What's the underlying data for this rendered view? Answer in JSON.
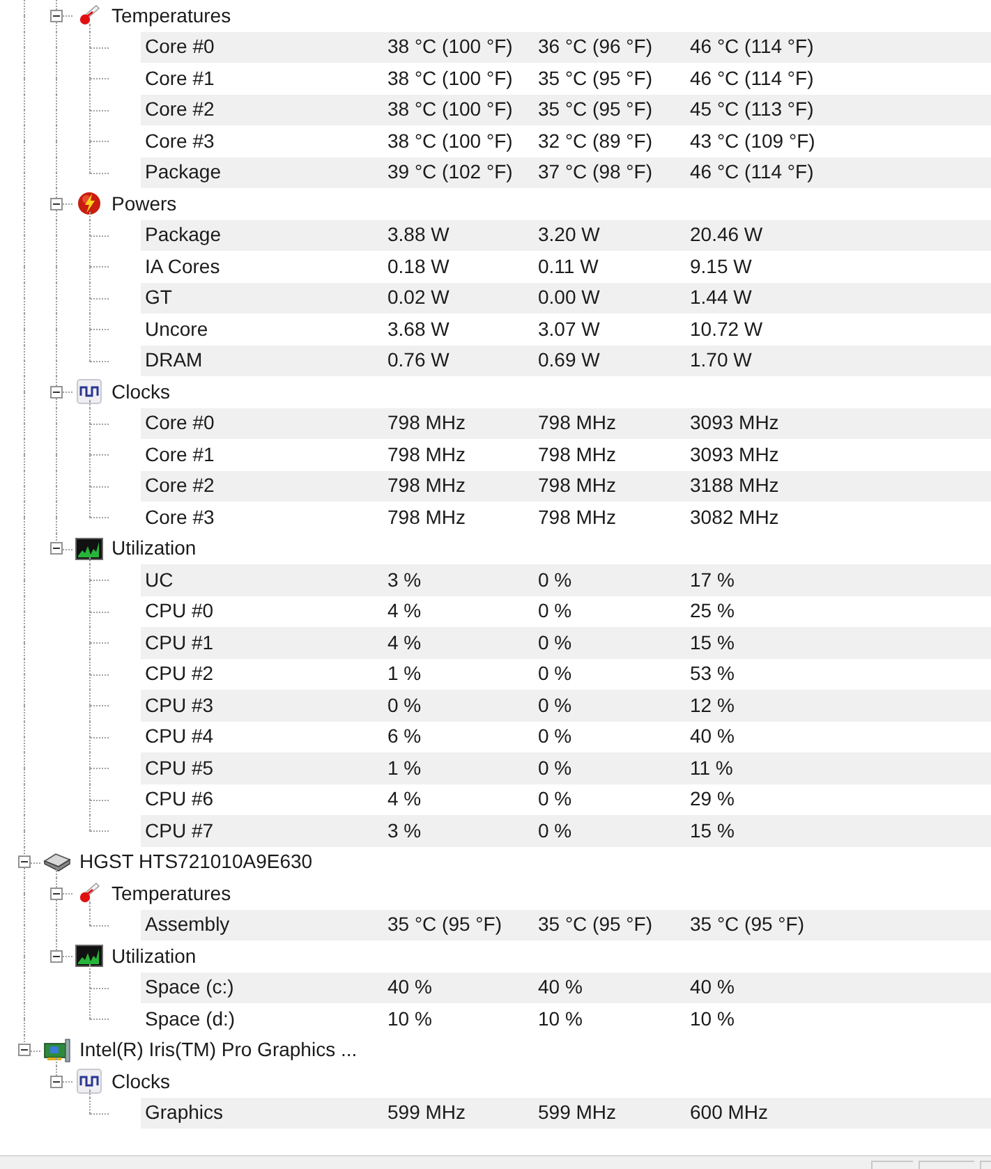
{
  "devices": [
    {
      "groups": [
        {
          "name": "Temperatures",
          "kind": "temperature",
          "expanded": true,
          "sensors": [
            {
              "name": "Core #0",
              "value": "38 °C (100 °F)",
              "min": "36 °C (96 °F)",
              "max": "46 °C (114 °F)"
            },
            {
              "name": "Core #1",
              "value": "38 °C (100 °F)",
              "min": "35 °C (95 °F)",
              "max": "46 °C (114 °F)"
            },
            {
              "name": "Core #2",
              "value": "38 °C (100 °F)",
              "min": "35 °C (95 °F)",
              "max": "45 °C (113 °F)"
            },
            {
              "name": "Core #3",
              "value": "38 °C (100 °F)",
              "min": "32 °C (89 °F)",
              "max": "43 °C (109 °F)"
            },
            {
              "name": "Package",
              "value": "39 °C (102 °F)",
              "min": "37 °C (98 °F)",
              "max": "46 °C (114 °F)"
            }
          ]
        },
        {
          "name": "Powers",
          "kind": "power",
          "expanded": true,
          "sensors": [
            {
              "name": "Package",
              "value": "3.88 W",
              "min": "3.20 W",
              "max": "20.46 W"
            },
            {
              "name": "IA Cores",
              "value": "0.18 W",
              "min": "0.11 W",
              "max": "9.15 W"
            },
            {
              "name": "GT",
              "value": "0.02 W",
              "min": "0.00 W",
              "max": "1.44 W"
            },
            {
              "name": "Uncore",
              "value": "3.68 W",
              "min": "3.07 W",
              "max": "10.72 W"
            },
            {
              "name": "DRAM",
              "value": "0.76 W",
              "min": "0.69 W",
              "max": "1.70 W"
            }
          ]
        },
        {
          "name": "Clocks",
          "kind": "clock",
          "expanded": true,
          "sensors": [
            {
              "name": "Core #0",
              "value": "798 MHz",
              "min": "798 MHz",
              "max": "3093 MHz"
            },
            {
              "name": "Core #1",
              "value": "798 MHz",
              "min": "798 MHz",
              "max": "3093 MHz"
            },
            {
              "name": "Core #2",
              "value": "798 MHz",
              "min": "798 MHz",
              "max": "3188 MHz"
            },
            {
              "name": "Core #3",
              "value": "798 MHz",
              "min": "798 MHz",
              "max": "3082 MHz"
            }
          ]
        },
        {
          "name": "Utilization",
          "kind": "utilization",
          "expanded": true,
          "sensors": [
            {
              "name": "UC",
              "value": "3 %",
              "min": "0 %",
              "max": "17 %"
            },
            {
              "name": "CPU #0",
              "value": "4 %",
              "min": "0 %",
              "max": "25 %"
            },
            {
              "name": "CPU #1",
              "value": "4 %",
              "min": "0 %",
              "max": "15 %"
            },
            {
              "name": "CPU #2",
              "value": "1 %",
              "min": "0 %",
              "max": "53 %"
            },
            {
              "name": "CPU #3",
              "value": "0 %",
              "min": "0 %",
              "max": "12 %"
            },
            {
              "name": "CPU #4",
              "value": "6 %",
              "min": "0 %",
              "max": "40 %"
            },
            {
              "name": "CPU #5",
              "value": "1 %",
              "min": "0 %",
              "max": "11 %"
            },
            {
              "name": "CPU #6",
              "value": "4 %",
              "min": "0 %",
              "max": "29 %"
            },
            {
              "name": "CPU #7",
              "value": "3 %",
              "min": "0 %",
              "max": "15 %"
            }
          ]
        }
      ]
    },
    {
      "name": "HGST HTS721010A9E630",
      "kind": "disk",
      "expanded": true,
      "groups": [
        {
          "name": "Temperatures",
          "kind": "temperature",
          "expanded": true,
          "sensors": [
            {
              "name": "Assembly",
              "value": "35 °C (95 °F)",
              "min": "35 °C (95 °F)",
              "max": "35 °C (95 °F)"
            }
          ]
        },
        {
          "name": "Utilization",
          "kind": "utilization",
          "expanded": true,
          "sensors": [
            {
              "name": "Space (c:)",
              "value": "40 %",
              "min": "40 %",
              "max": "40 %"
            },
            {
              "name": "Space (d:)",
              "value": "10 %",
              "min": "10 %",
              "max": "10 %"
            }
          ]
        }
      ]
    },
    {
      "name": "Intel(R) Iris(TM) Pro Graphics ...",
      "kind": "gpu",
      "expanded": true,
      "groups": [
        {
          "name": "Clocks",
          "kind": "clock",
          "expanded": true,
          "sensors": [
            {
              "name": "Graphics",
              "value": "599 MHz",
              "min": "599 MHz",
              "max": "600 MHz"
            }
          ]
        }
      ]
    }
  ]
}
